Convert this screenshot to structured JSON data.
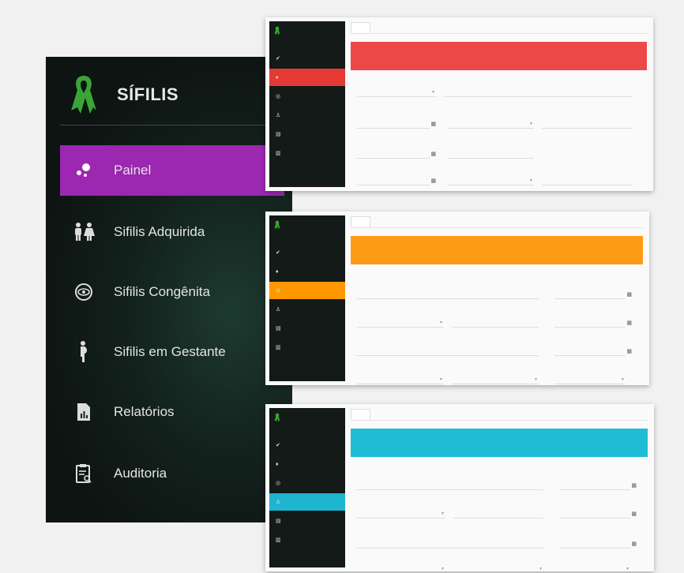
{
  "sidebar": {
    "app_title": "SÍFILIS",
    "items": [
      {
        "label": "Painel",
        "icon": "dots-icon",
        "active": true
      },
      {
        "label": "Sifilis Adquirida",
        "icon": "people-icon",
        "active": false
      },
      {
        "label": "Sifilis Congênita",
        "icon": "eye-icon",
        "active": false
      },
      {
        "label": "Sifilis em Gestante",
        "icon": "pregnant-icon",
        "active": false
      },
      {
        "label": "Relatórios",
        "icon": "report-icon",
        "active": false
      },
      {
        "label": "Auditoria",
        "icon": "audit-icon",
        "active": false
      }
    ]
  },
  "colors": {
    "sidebar_bg": "#0d1412",
    "active_item": "#9c27b0",
    "ribbon": "#3aa537",
    "red": "#ec4848",
    "orange": "#fd9b14",
    "cyan": "#1fbcd6"
  }
}
